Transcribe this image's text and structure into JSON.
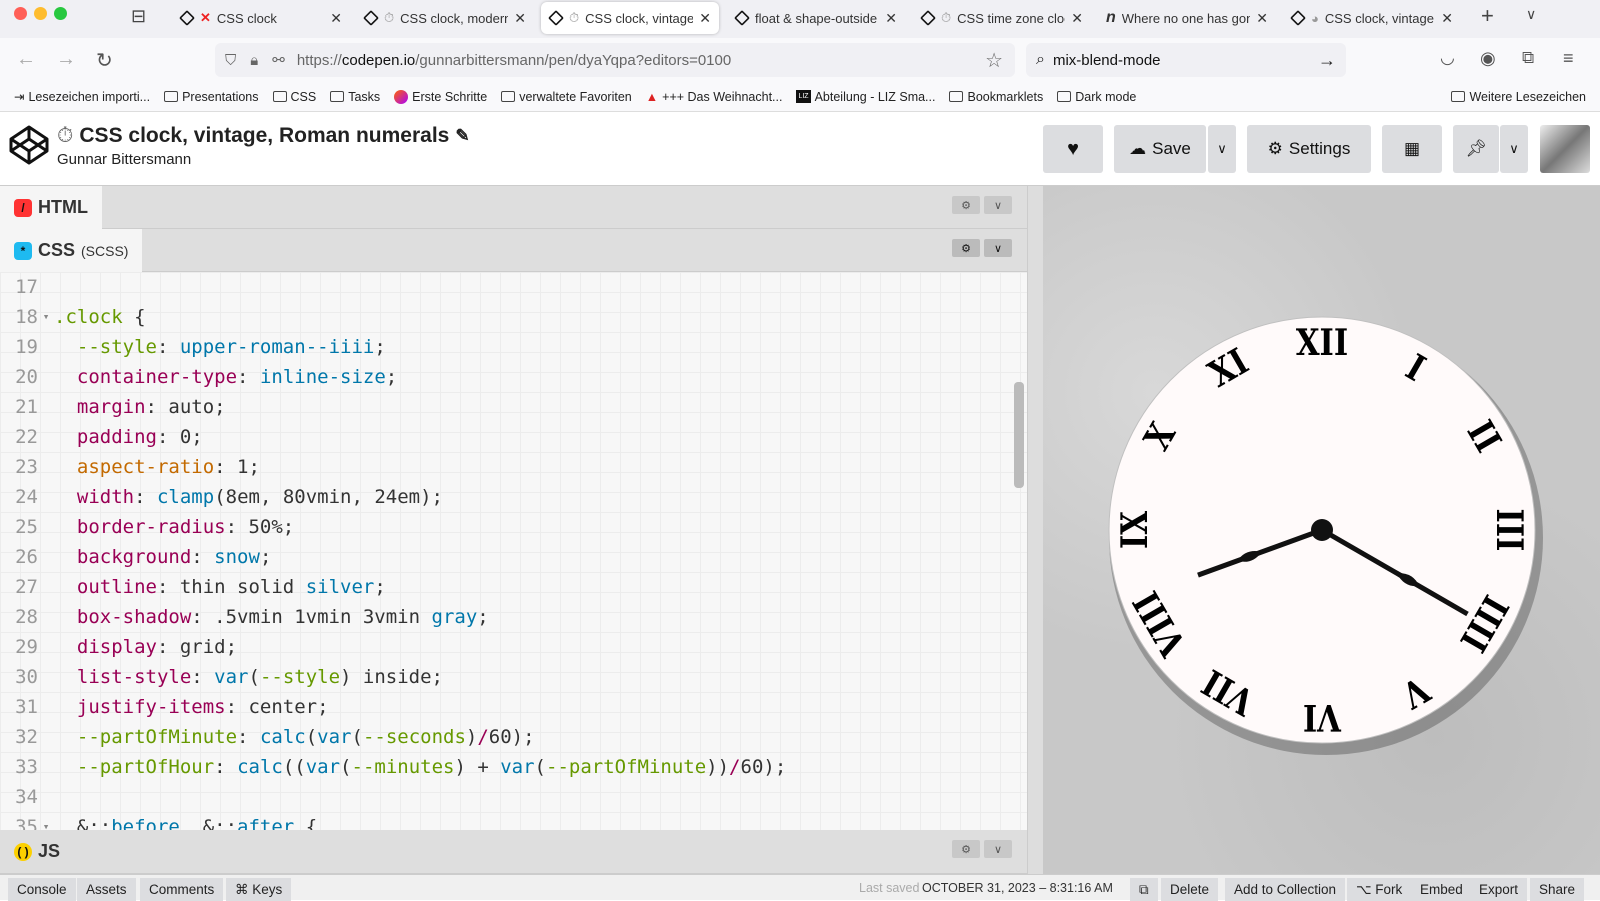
{
  "browser": {
    "tabs": [
      {
        "label": "CSS clock",
        "icon": "codepen-icon",
        "prefix": "✕"
      },
      {
        "label": "CSS clock, modern",
        "icon": "codepen-icon",
        "prefix": "⏱"
      },
      {
        "label": "CSS clock, vintage",
        "icon": "codepen-icon",
        "prefix": "⏱",
        "active": true
      },
      {
        "label": "float & shape-outside",
        "icon": "codepen-icon",
        "prefix": ""
      },
      {
        "label": "CSS time zone clock",
        "icon": "codepen-icon",
        "prefix": "⏱"
      },
      {
        "label": "Where no one has gone",
        "icon": "notion-icon",
        "prefix": ""
      },
      {
        "label": "CSS clock, vintage",
        "icon": "codepen-icon",
        "prefix": "◕"
      }
    ],
    "url_prefix": "https://",
    "url_domain": "codepen.io",
    "url_path": "/gunnarbittersmann/pen/dyaYqpa?editors=0100",
    "search_value": "mix-blend-mode",
    "bookmarks": [
      "Lesezeichen importi...",
      "Presentations",
      "CSS",
      "Tasks",
      "Erste Schritte",
      "verwaltete Favoriten",
      "+++ Das Weihnacht...",
      "Abteilung - LIZ Sma...",
      "Bookmarklets",
      "Dark mode"
    ],
    "other_bookmarks": "Weitere Lesezeichen"
  },
  "pen": {
    "title": "CSS clock, vintage, Roman numerals",
    "title_icon": "⏱",
    "author": "Gunnar Bittersmann",
    "save": "Save",
    "settings": "Settings"
  },
  "editors": {
    "html": "HTML",
    "css": "CSS",
    "css_sub": "(SCSS)",
    "js": "JS"
  },
  "code": [
    {
      "n": "17",
      "f": "",
      "tokens": []
    },
    {
      "n": "18",
      "f": "▾",
      "tokens": [
        [
          "g",
          ".clock"
        ],
        [
          "t",
          " {"
        ]
      ]
    },
    {
      "n": "19",
      "f": "",
      "tokens": [
        [
          "t",
          "  "
        ],
        [
          "g",
          "--style"
        ],
        [
          "t",
          ": "
        ],
        [
          "v",
          "upper-roman--iiii"
        ],
        [
          "t",
          ";"
        ]
      ]
    },
    {
      "n": "20",
      "f": "",
      "tokens": [
        [
          "t",
          "  "
        ],
        [
          "p",
          "container-type"
        ],
        [
          "t",
          ": "
        ],
        [
          "v",
          "inline-size"
        ],
        [
          "t",
          ";"
        ]
      ]
    },
    {
      "n": "21",
      "f": "",
      "tokens": [
        [
          "t",
          "  "
        ],
        [
          "p",
          "margin"
        ],
        [
          "t",
          ": auto;"
        ]
      ]
    },
    {
      "n": "22",
      "f": "",
      "tokens": [
        [
          "t",
          "  "
        ],
        [
          "p",
          "padding"
        ],
        [
          "t",
          ": 0;"
        ]
      ]
    },
    {
      "n": "23",
      "f": "",
      "tokens": [
        [
          "t",
          "  "
        ],
        [
          "o",
          "aspect-ratio"
        ],
        [
          "t",
          ": 1;"
        ]
      ]
    },
    {
      "n": "24",
      "f": "",
      "tokens": [
        [
          "t",
          "  "
        ],
        [
          "p",
          "width"
        ],
        [
          "t",
          ": "
        ],
        [
          "v",
          "clamp"
        ],
        [
          "t",
          "(8em, 80vmin, 24em);"
        ]
      ]
    },
    {
      "n": "25",
      "f": "",
      "tokens": [
        [
          "t",
          "  "
        ],
        [
          "p",
          "border-radius"
        ],
        [
          "t",
          ": 50%;"
        ]
      ]
    },
    {
      "n": "26",
      "f": "",
      "tokens": [
        [
          "t",
          "  "
        ],
        [
          "p",
          "background"
        ],
        [
          "t",
          ": "
        ],
        [
          "v",
          "snow"
        ],
        [
          "t",
          ";"
        ]
      ]
    },
    {
      "n": "27",
      "f": "",
      "tokens": [
        [
          "t",
          "  "
        ],
        [
          "p",
          "outline"
        ],
        [
          "t",
          ": thin solid "
        ],
        [
          "v",
          "silver"
        ],
        [
          "t",
          ";"
        ]
      ]
    },
    {
      "n": "28",
      "f": "",
      "tokens": [
        [
          "t",
          "  "
        ],
        [
          "p",
          "box-shadow"
        ],
        [
          "t",
          ": .5vmin 1vmin 3vmin "
        ],
        [
          "v",
          "gray"
        ],
        [
          "t",
          ";"
        ]
      ]
    },
    {
      "n": "29",
      "f": "",
      "tokens": [
        [
          "t",
          "  "
        ],
        [
          "p",
          "display"
        ],
        [
          "t",
          ": grid;"
        ]
      ]
    },
    {
      "n": "30",
      "f": "",
      "tokens": [
        [
          "t",
          "  "
        ],
        [
          "p",
          "list-style"
        ],
        [
          "t",
          ": "
        ],
        [
          "v",
          "var"
        ],
        [
          "t",
          "("
        ],
        [
          "g",
          "--style"
        ],
        [
          "t",
          ") inside;"
        ]
      ]
    },
    {
      "n": "31",
      "f": "",
      "tokens": [
        [
          "t",
          "  "
        ],
        [
          "p",
          "justify-items"
        ],
        [
          "t",
          ": center;"
        ]
      ]
    },
    {
      "n": "32",
      "f": "",
      "tokens": [
        [
          "t",
          "  "
        ],
        [
          "g",
          "--partOfMinute"
        ],
        [
          "t",
          ": "
        ],
        [
          "v",
          "calc"
        ],
        [
          "t",
          "("
        ],
        [
          "v",
          "var"
        ],
        [
          "t",
          "("
        ],
        [
          "g",
          "--seconds"
        ],
        [
          "t",
          ")"
        ],
        [
          "p",
          "/"
        ],
        [
          "t",
          "60);"
        ]
      ]
    },
    {
      "n": "33",
      "f": "",
      "tokens": [
        [
          "t",
          "  "
        ],
        [
          "g",
          "--partOfHour"
        ],
        [
          "t",
          ": "
        ],
        [
          "v",
          "calc"
        ],
        [
          "t",
          "(("
        ],
        [
          "v",
          "var"
        ],
        [
          "t",
          "("
        ],
        [
          "g",
          "--minutes"
        ],
        [
          "t",
          ") + "
        ],
        [
          "v",
          "var"
        ],
        [
          "t",
          "("
        ],
        [
          "g",
          "--partOfMinute"
        ],
        [
          "t",
          "))"
        ],
        [
          "p",
          "/"
        ],
        [
          "t",
          "60);"
        ]
      ]
    },
    {
      "n": "34",
      "f": "",
      "tokens": []
    },
    {
      "n": "35",
      "f": "▾",
      "tokens": [
        [
          "t",
          "  &::"
        ],
        [
          "v",
          "before"
        ],
        [
          "t",
          ", &::"
        ],
        [
          "v",
          "after"
        ],
        [
          "t",
          " {"
        ]
      ]
    }
  ],
  "clock": {
    "numerals": [
      "XII",
      "I",
      "II",
      "III",
      "IIII",
      "V",
      "VI",
      "VII",
      "VIII",
      "IX",
      "X",
      "XI"
    ],
    "hour": 8,
    "minute": 20
  },
  "footer": {
    "tabs": [
      "Console",
      "Assets",
      "Comments",
      "⌘ Keys"
    ],
    "last_saved_label": "Last saved",
    "last_saved_value": "OCTOBER 31, 2023 – 8:31:16 AM",
    "actions": [
      "Delete",
      "Add to Collection",
      "⌥ Fork",
      "Embed",
      "Export",
      "Share"
    ]
  }
}
